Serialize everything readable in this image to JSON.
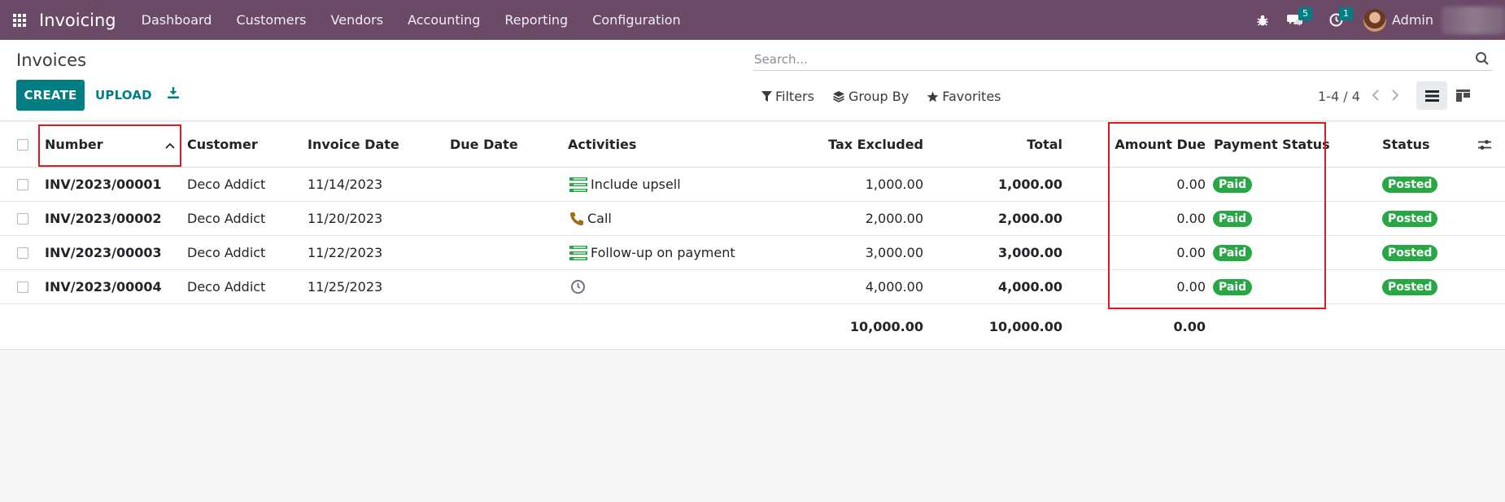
{
  "navbar": {
    "brand": "Invoicing",
    "menu": [
      "Dashboard",
      "Customers",
      "Vendors",
      "Accounting",
      "Reporting",
      "Configuration"
    ],
    "messages_count": "5",
    "activities_count": "1",
    "user_name": "Admin"
  },
  "control": {
    "title": "Invoices",
    "create_label": "CREATE",
    "upload_label": "UPLOAD",
    "search_placeholder": "Search...",
    "filters_label": "Filters",
    "groupby_label": "Group By",
    "favorites_label": "Favorites",
    "pager_text": "1-4 / 4"
  },
  "table": {
    "columns": {
      "number": "Number",
      "customer": "Customer",
      "invoice_date": "Invoice Date",
      "due_date": "Due Date",
      "activities": "Activities",
      "tax_excluded": "Tax Excluded",
      "total": "Total",
      "amount_due": "Amount Due",
      "payment_status": "Payment Status",
      "status": "Status"
    },
    "rows": [
      {
        "number": "INV/2023/00001",
        "customer": "Deco Addict",
        "invoice_date": "11/14/2023",
        "due_date": "",
        "activity": "Include upsell",
        "activity_icon": "upsell-icon",
        "tax_excluded": "1,000.00",
        "total": "1,000.00",
        "amount_due": "0.00",
        "payment_status": "Paid",
        "status": "Posted"
      },
      {
        "number": "INV/2023/00002",
        "customer": "Deco Addict",
        "invoice_date": "11/20/2023",
        "due_date": "",
        "activity": "Call",
        "activity_icon": "phone-icon",
        "tax_excluded": "2,000.00",
        "total": "2,000.00",
        "amount_due": "0.00",
        "payment_status": "Paid",
        "status": "Posted"
      },
      {
        "number": "INV/2023/00003",
        "customer": "Deco Addict",
        "invoice_date": "11/22/2023",
        "due_date": "",
        "activity": "Follow-up on payment",
        "activity_icon": "upsell-icon",
        "tax_excluded": "3,000.00",
        "total": "3,000.00",
        "amount_due": "0.00",
        "payment_status": "Paid",
        "status": "Posted"
      },
      {
        "number": "INV/2023/00004",
        "customer": "Deco Addict",
        "invoice_date": "11/25/2023",
        "due_date": "",
        "activity": "",
        "activity_icon": "clock-icon",
        "tax_excluded": "4,000.00",
        "total": "4,000.00",
        "amount_due": "0.00",
        "payment_status": "Paid",
        "status": "Posted"
      }
    ],
    "totals": {
      "tax_excluded": "10,000.00",
      "total": "10,000.00",
      "amount_due": "0.00"
    }
  },
  "colors": {
    "navbar": "#6b4a68",
    "primary": "#017e84",
    "success": "#28a745",
    "highlight": "#e0191f"
  }
}
